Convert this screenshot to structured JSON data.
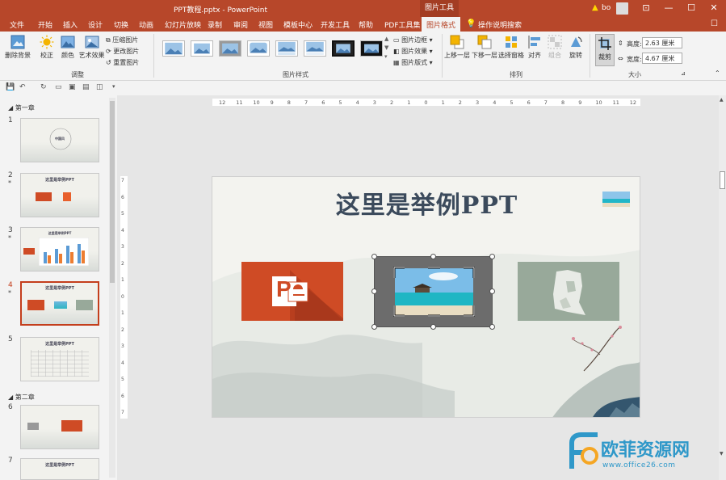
{
  "window": {
    "title": "PPT教程.pptx  -  PowerPoint",
    "tools_tab": "图片工具",
    "user": "bo",
    "minimize": "—",
    "restore": "❐",
    "maximize": "☐",
    "close": "✕",
    "ribbon_display": "⊡"
  },
  "menu": {
    "tabs": [
      "文件",
      "开始",
      "插入",
      "设计",
      "切换",
      "动画",
      "幻灯片放映",
      "录制",
      "审阅",
      "视图",
      "模板中心",
      "开发工具",
      "帮助",
      "PDF工具集",
      "图片格式"
    ],
    "active_tab": "图片格式",
    "tell_me": "操作说明搜索"
  },
  "ribbon": {
    "remove_bg": "删除背景",
    "corrections": "校正",
    "color": "颜色",
    "artistic": "艺术效果",
    "compress": "压缩图片",
    "change_pic": "更改图片",
    "reset_pic": "重置图片",
    "group_adjust": "调整",
    "pic_border": "图片边框",
    "pic_effects": "图片效果",
    "pic_layout": "图片版式",
    "group_styles": "图片样式",
    "bring_forward": "上移一层",
    "send_backward": "下移一层",
    "selection_pane": "选择窗格",
    "align": "对齐",
    "group": "组合",
    "rotate": "旋转",
    "group_arrange": "排列",
    "crop": "裁剪",
    "height_label": "高度:",
    "height_value": "2.63 厘米",
    "width_label": "宽度:",
    "width_value": "4.67 厘米",
    "group_size": "大小"
  },
  "slides_panel": {
    "section1": "第一章",
    "section2": "第二章",
    "items": [
      {
        "num": "1",
        "star": "",
        "title": "中国风"
      },
      {
        "num": "2",
        "star": "*",
        "title": "这里是举例PPT"
      },
      {
        "num": "3",
        "star": "*",
        "title": "这里是举例PPT"
      },
      {
        "num": "4",
        "star": "*",
        "title": "这里是举例PPT"
      },
      {
        "num": "5",
        "star": "",
        "title": "这里是举例PPT"
      },
      {
        "num": "6",
        "star": "",
        "title": ""
      },
      {
        "num": "7",
        "star": "",
        "title": "这里是举例PPT"
      }
    ],
    "active": "4"
  },
  "slide": {
    "title": "这里是举例PPT",
    "ppt_letter": "P"
  },
  "ruler": {
    "h_ticks": [
      "12",
      "11",
      "10",
      "9",
      "8",
      "7",
      "6",
      "5",
      "4",
      "3",
      "2",
      "1",
      "0",
      "1",
      "2",
      "3",
      "4",
      "5",
      "6",
      "7",
      "8",
      "9",
      "10",
      "11",
      "12"
    ],
    "v_ticks": [
      "7",
      "6",
      "5",
      "4",
      "3",
      "2",
      "1",
      "0",
      "1",
      "2",
      "3",
      "4",
      "5",
      "6",
      "7"
    ]
  },
  "watermark": {
    "text": "欧菲资源网",
    "url": "www.office26.com"
  },
  "colors": {
    "accent": "#b7472a",
    "ppt_orange": "#cf4b25",
    "watermark_blue": "#2f98c9"
  }
}
